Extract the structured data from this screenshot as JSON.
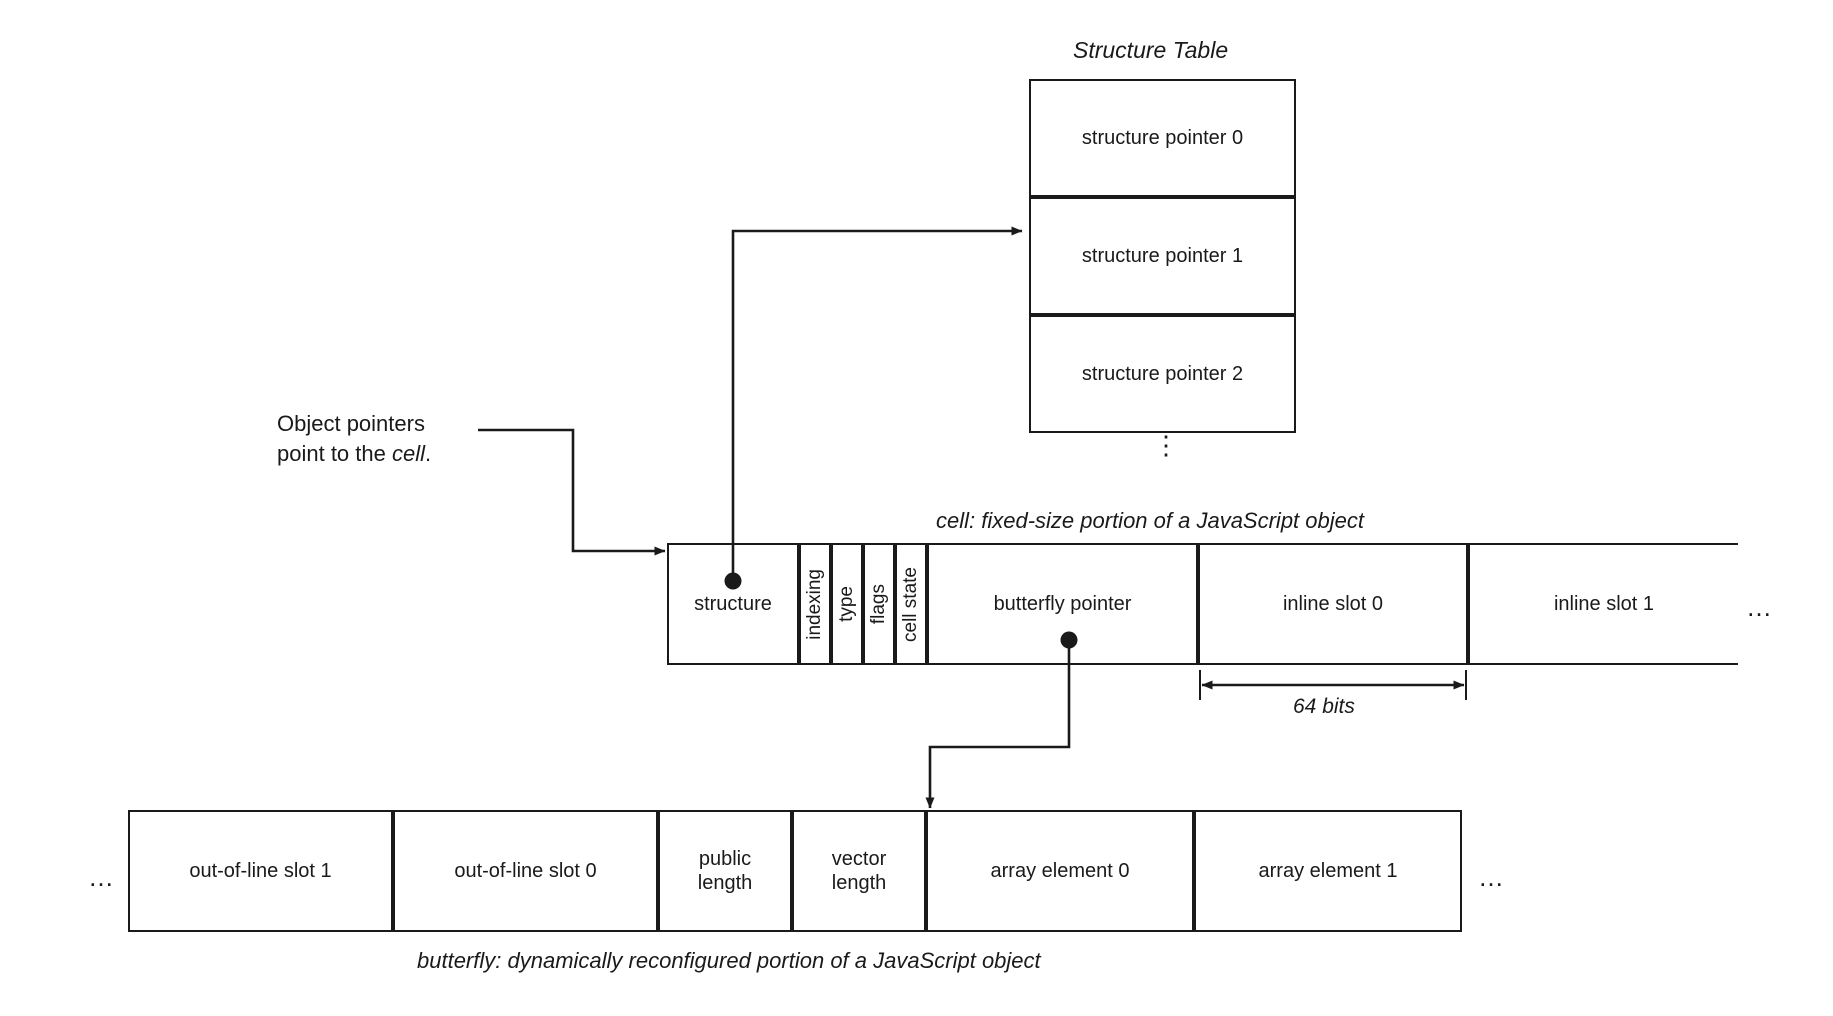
{
  "diagram": {
    "title_structure_table": "Structure Table",
    "structure_table_rows": [
      "structure pointer 0",
      "structure pointer 1",
      "structure pointer 2"
    ],
    "structure_table_more": "⋮",
    "annotation": {
      "line1": "Object pointers",
      "line2_prefix": "point to the ",
      "line2_em": "cell",
      "line2_suffix": "."
    },
    "cell": {
      "caption": "cell: fixed-size portion of a JavaScript object",
      "fields": [
        {
          "label": "structure",
          "orientation": "horizontal"
        },
        {
          "label": "indexing",
          "orientation": "vertical"
        },
        {
          "label": "type",
          "orientation": "vertical"
        },
        {
          "label": "flags",
          "orientation": "vertical"
        },
        {
          "label": "cell state",
          "orientation": "vertical"
        },
        {
          "label": "butterfly pointer",
          "orientation": "horizontal"
        },
        {
          "label": "inline slot 0",
          "orientation": "horizontal"
        },
        {
          "label": "inline slot 1",
          "orientation": "horizontal"
        }
      ],
      "trailing_ellipsis": "…",
      "dimension_label": "64 bits"
    },
    "butterfly": {
      "caption": "butterfly: dynamically reconfigured portion of a JavaScript object",
      "leading_ellipsis": "…",
      "trailing_ellipsis": "…",
      "fields": [
        {
          "label": "out-of-line slot 1"
        },
        {
          "label": "out-of-line slot 0"
        },
        {
          "label": "public\nlength"
        },
        {
          "label": "vector\nlength"
        },
        {
          "label": "array element 0"
        },
        {
          "label": "array element 1"
        }
      ]
    },
    "colors": {
      "stroke": "#1a1a1a",
      "background": "#ffffff",
      "text": "#1a1a1a"
    }
  }
}
